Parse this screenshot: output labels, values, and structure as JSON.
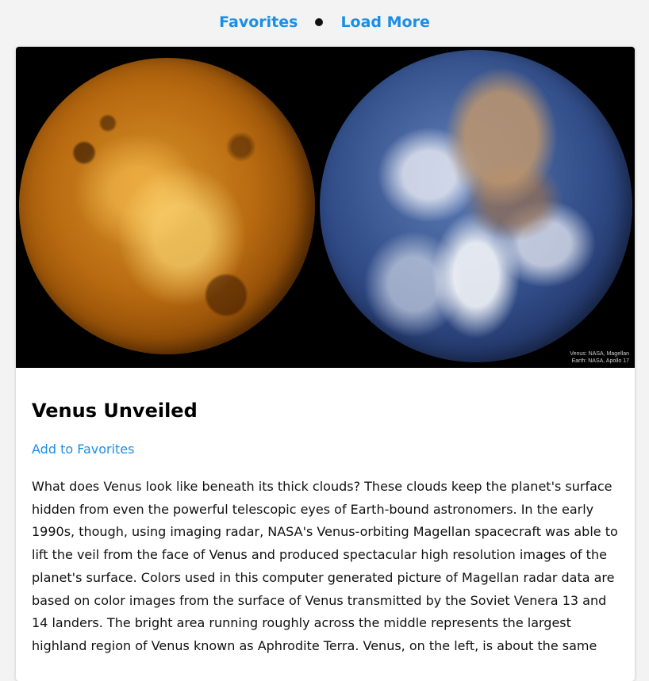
{
  "nav": {
    "favorites_label": "Favorites",
    "load_more_label": "Load More"
  },
  "image": {
    "alt": "Venus and Earth side by side",
    "credit_line_1": "Venus: NASA, Magellan",
    "credit_line_2": "Earth: NASA, Apollo 17"
  },
  "article": {
    "title": "Venus Unveiled",
    "add_favorites_label": "Add to Favorites",
    "description": "What does Venus look like beneath its thick clouds? These clouds keep the planet's surface hidden from even the powerful telescopic eyes of Earth-bound astronomers. In the early 1990s, though, using imaging radar, NASA's Venus-orbiting Magellan spacecraft was able to lift the veil from the face of Venus and produced spectacular high resolution images of the planet's surface. Colors used in this computer generated picture of Magellan radar data are based on color images from the surface of Venus transmitted by the Soviet Venera 13 and 14 landers. The bright area running roughly across the middle represents the largest highland region of Venus known as Aphrodite Terra. Venus, on the left, is about the same"
  },
  "colors": {
    "link": "#1a8fe8",
    "background": "#f3f3f3",
    "card": "#ffffff"
  },
  "icons": [
    "bullet-separator-icon"
  ]
}
